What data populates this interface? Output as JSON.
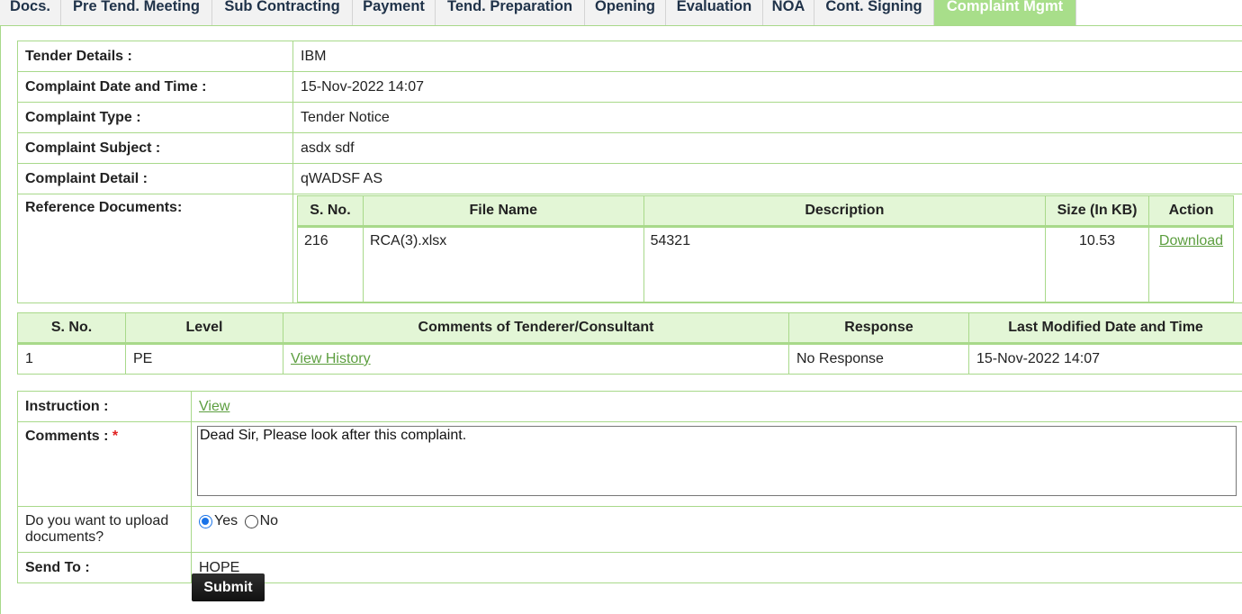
{
  "tabs": [
    {
      "label": "Docs."
    },
    {
      "label": "Pre Tend. Meeting"
    },
    {
      "label": "Sub Contracting"
    },
    {
      "label": "Payment"
    },
    {
      "label": "Tend. Preparation"
    },
    {
      "label": "Opening"
    },
    {
      "label": "Evaluation"
    },
    {
      "label": "NOA"
    },
    {
      "label": "Cont. Signing"
    },
    {
      "label": "Complaint Mgmt",
      "active": true
    }
  ],
  "details": {
    "tender_label": "Tender Details :",
    "tender_value": "IBM",
    "date_label": "Complaint Date and Time :",
    "date_value": "15-Nov-2022 14:07",
    "type_label": "Complaint Type :",
    "type_value": "Tender Notice",
    "subject_label": "Complaint Subject :",
    "subject_value": "asdx sdf",
    "detail_label": "Complaint Detail :",
    "detail_value": "qWADSF AS",
    "ref_label": "Reference Documents:"
  },
  "docs": {
    "headers": [
      "S. No.",
      "File Name",
      "Description",
      "Size (In KB)",
      "Action"
    ],
    "rows": [
      {
        "sno": "216",
        "file": "RCA(3).xlsx",
        "desc": "54321",
        "size": "10.53",
        "action": "Download"
      }
    ]
  },
  "responses": {
    "headers": [
      "S. No.",
      "Level",
      "Comments of Tenderer/Consultant",
      "Response",
      "Last Modified Date and Time"
    ],
    "rows": [
      {
        "sno": "1",
        "level": "PE",
        "comments": "View History",
        "response": "No Response",
        "modified": "15-Nov-2022 14:07"
      }
    ]
  },
  "form": {
    "instruction_label": "Instruction :",
    "instruction_link": "View",
    "comments_label": "Comments :",
    "required_mark": "*",
    "comments_value": "Dead Sir, Please look after this complaint.",
    "upload_label": "Do you want to upload documents?",
    "upload_yes": "Yes",
    "upload_no": "No",
    "upload_selected": "Yes",
    "sendto_label": "Send To :",
    "sendto_value": "HOPE",
    "submit_label": "Submit"
  },
  "colors": {
    "accent_green": "#a8de8a",
    "header_bg": "#e3f6d6",
    "link_green": "#5c9e3f",
    "tab_text": "#1f3249"
  }
}
